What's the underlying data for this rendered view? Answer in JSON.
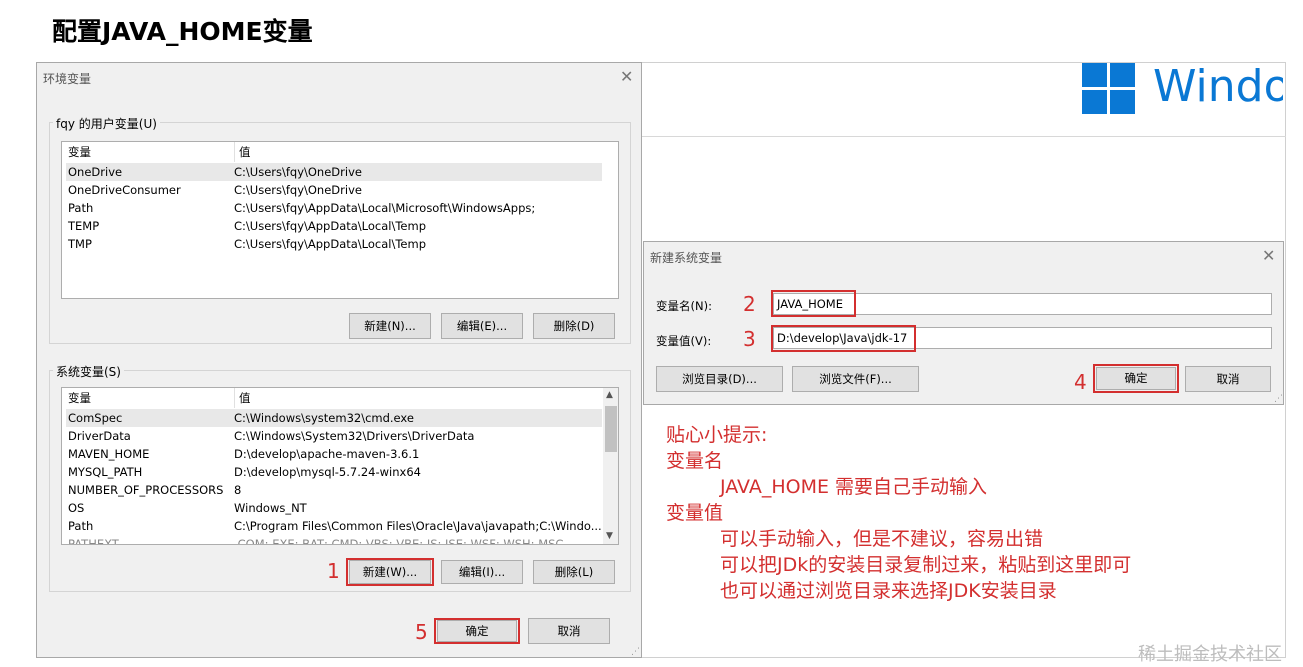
{
  "page_title": "配置JAVA_HOME变量",
  "windows_brand": {
    "text": "Windo",
    "color": "#0a78d4"
  },
  "env_dialog": {
    "title": "环境变量",
    "user_group_label": "fqy 的用户变量(U)",
    "columns": {
      "var": "变量",
      "value": "值"
    },
    "user_vars": [
      {
        "name": "OneDrive",
        "value": "C:\\Users\\fqy\\OneDrive"
      },
      {
        "name": "OneDriveConsumer",
        "value": "C:\\Users\\fqy\\OneDrive"
      },
      {
        "name": "Path",
        "value": "C:\\Users\\fqy\\AppData\\Local\\Microsoft\\WindowsApps;"
      },
      {
        "name": "TEMP",
        "value": "C:\\Users\\fqy\\AppData\\Local\\Temp"
      },
      {
        "name": "TMP",
        "value": "C:\\Users\\fqy\\AppData\\Local\\Temp"
      }
    ],
    "user_buttons": {
      "new": "新建(N)...",
      "edit": "编辑(E)...",
      "delete": "删除(D)"
    },
    "system_group_label": "系统变量(S)",
    "system_vars": [
      {
        "name": "ComSpec",
        "value": "C:\\Windows\\system32\\cmd.exe"
      },
      {
        "name": "DriverData",
        "value": "C:\\Windows\\System32\\Drivers\\DriverData"
      },
      {
        "name": "MAVEN_HOME",
        "value": "D:\\develop\\apache-maven-3.6.1"
      },
      {
        "name": "MYSQL_PATH",
        "value": "D:\\develop\\mysql-5.7.24-winx64"
      },
      {
        "name": "NUMBER_OF_PROCESSORS",
        "value": "8"
      },
      {
        "name": "OS",
        "value": "Windows_NT"
      },
      {
        "name": "Path",
        "value": "C:\\Program Files\\Common Files\\Oracle\\Java\\javapath;C:\\Windo..."
      },
      {
        "name": "PATHEXT",
        "value": ".COM;.EXE;.BAT;.CMD;.VBS;.VBE;.JS;.JSE;.WSF;.WSH;.MSC"
      }
    ],
    "system_buttons": {
      "new": "新建(W)...",
      "edit": "编辑(I)...",
      "delete": "删除(L)"
    },
    "ok": "确定",
    "cancel": "取消"
  },
  "new_dialog": {
    "title": "新建系统变量",
    "name_label": "变量名(N):",
    "name_value": "JAVA_HOME",
    "value_label": "变量值(V):",
    "value_value": "D:\\develop\\Java\\jdk-17",
    "browse_dir": "浏览目录(D)...",
    "browse_file": "浏览文件(F)...",
    "ok": "确定",
    "cancel": "取消"
  },
  "steps": [
    "1",
    "2",
    "3",
    "4",
    "5"
  ],
  "tips": {
    "heading": "贴心小提示:",
    "name_title": "变量名",
    "name_line": "JAVA_HOME 需要自己手动输入",
    "value_title": "变量值",
    "value_lines": [
      "可以手动输入，但是不建议，容易出错",
      "可以把JDk的安装目录复制过来，粘贴到这里即可",
      "也可以通过浏览目录来选择JDK安装目录"
    ]
  },
  "watermark": "稀土掘金技术社区",
  "accent_red": "#d32f2f"
}
